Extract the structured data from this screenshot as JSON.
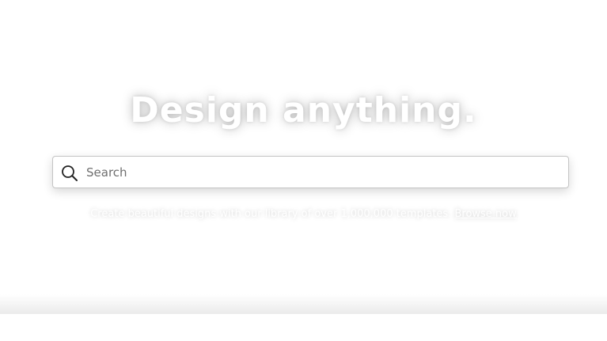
{
  "hero": {
    "title": "Design anything.",
    "search": {
      "placeholder": "Search",
      "value": ""
    },
    "subtext": "Create beautiful designs with our library of over 1,000,000 templates.",
    "subtext_link": "Browse now"
  },
  "icons": {
    "search": "search-icon"
  },
  "colors": {
    "background": "#ffffff",
    "headline": "#ffffff",
    "search_border": "#c4c4c4",
    "placeholder": "#6f6f6f"
  }
}
